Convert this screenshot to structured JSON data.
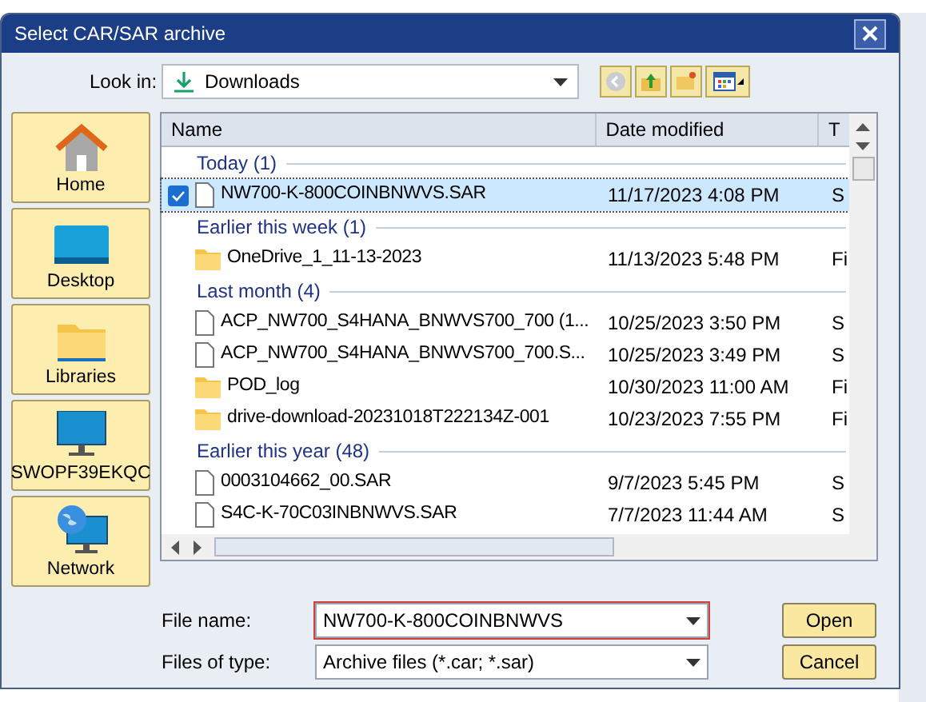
{
  "window": {
    "title": "Select CAR/SAR archive"
  },
  "look_in": {
    "label": "Look in:",
    "value": "Downloads"
  },
  "places": [
    {
      "label": "Home",
      "kind": "home"
    },
    {
      "label": "Desktop",
      "kind": "desktop"
    },
    {
      "label": "Libraries",
      "kind": "libraries"
    },
    {
      "label": "SWOPF39EKQC",
      "kind": "computer"
    },
    {
      "label": "Network",
      "kind": "network"
    }
  ],
  "columns": [
    "Name",
    "Date modified",
    "T"
  ],
  "rows": [
    {
      "kind": "group",
      "label": "Today (1)"
    },
    {
      "kind": "file",
      "name": "NW700-K-800COINBNWVS.SAR",
      "date": "11/17/2023 4:08 PM",
      "column_3": "S",
      "selected": true,
      "checked": true
    },
    {
      "kind": "group",
      "label": "Earlier this week (1)"
    },
    {
      "kind": "folder",
      "name": "OneDrive_1_11-13-2023",
      "date": "11/13/2023 5:48 PM",
      "column_3": "Fi",
      "selected": false,
      "checked": false
    },
    {
      "kind": "group",
      "label": "Last month (4)"
    },
    {
      "kind": "file",
      "name": "ACP_NW700_S4HANA_BNWVS700_700 (1...",
      "date": "10/25/2023 3:50 PM",
      "column_3": "S",
      "selected": false,
      "checked": false
    },
    {
      "kind": "file",
      "name": "ACP_NW700_S4HANA_BNWVS700_700.S...",
      "date": "10/25/2023 3:49 PM",
      "column_3": "S",
      "selected": false,
      "checked": false
    },
    {
      "kind": "folder",
      "name": "POD_log",
      "date": "10/30/2023 11:00 AM",
      "column_3": "Fi",
      "selected": false,
      "checked": false
    },
    {
      "kind": "folder",
      "name": "drive-download-20231018T222134Z-001",
      "date": "10/23/2023 7:55 PM",
      "column_3": "Fi",
      "selected": false,
      "checked": false
    },
    {
      "kind": "group",
      "label": "Earlier this year (48)"
    },
    {
      "kind": "file",
      "name": "0003104662_00.SAR",
      "date": "9/7/2023 5:45 PM",
      "column_3": "S",
      "selected": false,
      "checked": false
    },
    {
      "kind": "file",
      "name": "S4C-K-70C03INBNWVS.SAR",
      "date": "7/7/2023 11:44 AM",
      "column_3": "S",
      "selected": false,
      "checked": false
    }
  ],
  "file_name": {
    "label": "File name:",
    "value": "NW700-K-800COINBNWVS"
  },
  "file_type": {
    "label": "Files of type:",
    "value": "Archive files (*.car; *.sar)"
  },
  "buttons": [
    "Open",
    "Cancel"
  ]
}
